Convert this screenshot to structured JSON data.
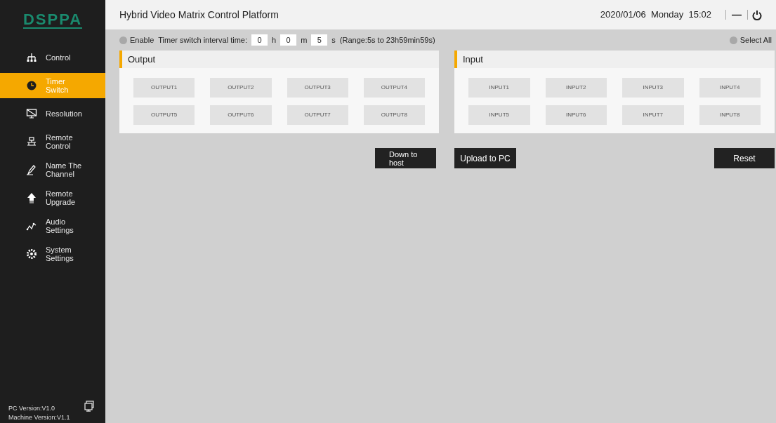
{
  "logo": "DSPPA",
  "sidebar": {
    "items": [
      {
        "label": "Control",
        "selected": false
      },
      {
        "label": "Timer Switch",
        "selected": true
      },
      {
        "label": "Resolution",
        "selected": false
      },
      {
        "label": "Remote Control",
        "selected": false
      },
      {
        "label": "Name The Channel",
        "selected": false
      },
      {
        "label": "Remote Upgrade",
        "selected": false
      },
      {
        "label": "Audio Settings",
        "selected": false
      },
      {
        "label": "System Settings",
        "selected": false
      }
    ],
    "pc_version": "PC Version:V1.0",
    "machine_version": "Machine Version:V1.1"
  },
  "header": {
    "title": "Hybrid Video Matrix Control Platform",
    "datetime": "2020/01/06  Monday  15:02",
    "minimize": "—"
  },
  "timer": {
    "enable": {
      "label": "Enable",
      "checked": false
    },
    "label": "Timer switch interval time:",
    "hours": "0",
    "h": "h",
    "minutes": "0",
    "m": "m",
    "seconds": "5",
    "s": "s",
    "range": "(Range:5s to 23h59min59s)"
  },
  "select_all": {
    "label": "Select All",
    "checked": false
  },
  "output": {
    "title": "Output",
    "channels": [
      {
        "label": "OUTPUT1",
        "selected": false
      },
      {
        "label": "OUTPUT2",
        "selected": false
      },
      {
        "label": "OUTPUT3",
        "selected": false
      },
      {
        "label": "OUTPUT4",
        "selected": false
      },
      {
        "label": "OUTPUT5",
        "selected": false
      },
      {
        "label": "OUTPUT6",
        "selected": false
      },
      {
        "label": "OUTPUT7",
        "selected": false
      },
      {
        "label": "OUTPUT8",
        "selected": false
      }
    ]
  },
  "input": {
    "title": "Input",
    "channels": [
      {
        "label": "INPUT1",
        "selected": false
      },
      {
        "label": "INPUT2",
        "selected": false
      },
      {
        "label": "INPUT3",
        "selected": false
      },
      {
        "label": "INPUT4",
        "selected": false
      },
      {
        "label": "INPUT5",
        "selected": false
      },
      {
        "label": "INPUT6",
        "selected": false
      },
      {
        "label": "INPUT7",
        "selected": false
      },
      {
        "label": "INPUT8",
        "selected": false
      }
    ]
  },
  "buttons": {
    "down": "Down to host",
    "upload": "Upload to PC",
    "reset": "Reset"
  }
}
